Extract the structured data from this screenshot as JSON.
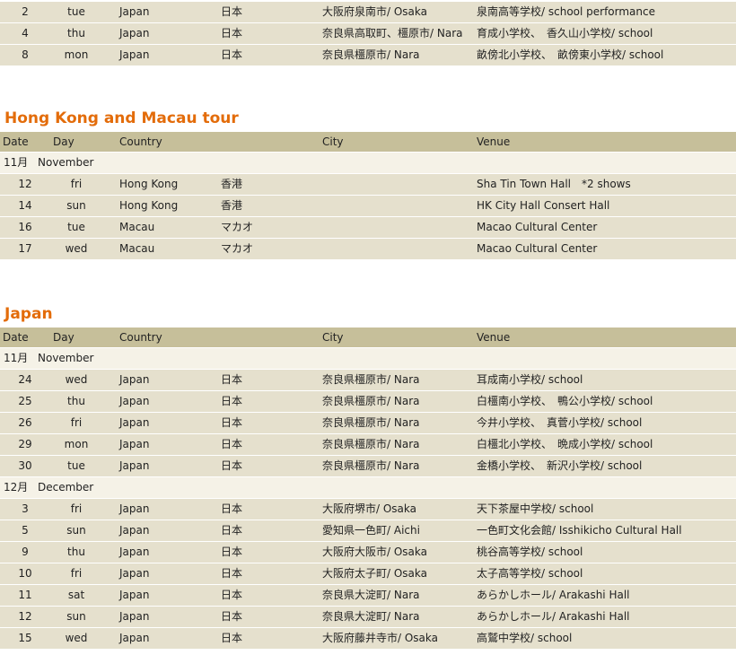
{
  "top_rows": [
    {
      "date": "2",
      "day": "tue",
      "country": "Japan",
      "ja": "日本",
      "city": "大阪府泉南市/ Osaka",
      "venue": "泉南高等学校/ school performance"
    },
    {
      "date": "4",
      "day": "thu",
      "country": "Japan",
      "ja": "日本",
      "city": "奈良県高取町、橿原市/ Nara",
      "venue": "育成小学校、　香久山小学校/ school"
    },
    {
      "date": "8",
      "day": "mon",
      "country": "Japan",
      "ja": "日本",
      "city": "奈良県橿原市/ Nara",
      "venue": "畝傍北小学校、　畝傍東小学校/ school"
    }
  ],
  "hk": {
    "title": "Hong Kong and Macau tour",
    "header": {
      "date": "Date",
      "day": "Day",
      "country": "Country",
      "city": "City",
      "venue": "Venue"
    },
    "month": {
      "num": "11月",
      "name": "November"
    },
    "rows": [
      {
        "date": "12",
        "day": "fri",
        "country": "Hong Kong",
        "ja": "香港",
        "city": "",
        "venue": "Sha Tin Town Hall　*2 shows"
      },
      {
        "date": "14",
        "day": "sun",
        "country": "Hong Kong",
        "ja": "香港",
        "city": "",
        "venue": "HK City Hall Consert Hall"
      },
      {
        "date": "16",
        "day": "tue",
        "country": "Macau",
        "ja": "マカオ",
        "city": "",
        "venue": "Macao Cultural Center"
      },
      {
        "date": "17",
        "day": "wed",
        "country": "Macau",
        "ja": "マカオ",
        "city": "",
        "venue": "Macao Cultural Center"
      }
    ]
  },
  "jp": {
    "title": "Japan",
    "header": {
      "date": "Date",
      "day": "Day",
      "country": "Country",
      "city": "City",
      "venue": "Venue"
    },
    "months": [
      {
        "num": "11月",
        "name": "November",
        "rows": [
          {
            "date": "24",
            "day": "wed",
            "country": "Japan",
            "ja": "日本",
            "city": "奈良県橿原市/ Nara",
            "venue": "耳成南小学校/ school"
          },
          {
            "date": "25",
            "day": "thu",
            "country": "Japan",
            "ja": "日本",
            "city": "奈良県橿原市/ Nara",
            "venue": "白橿南小学校、　鴨公小学校/ school"
          },
          {
            "date": "26",
            "day": "fri",
            "country": "Japan",
            "ja": "日本",
            "city": "奈良県橿原市/ Nara",
            "venue": "今井小学校、　真菅小学校/ school"
          },
          {
            "date": "29",
            "day": "mon",
            "country": "Japan",
            "ja": "日本",
            "city": "奈良県橿原市/ Nara",
            "venue": "白橿北小学校、　晩成小学校/ school"
          },
          {
            "date": "30",
            "day": "tue",
            "country": "Japan",
            "ja": "日本",
            "city": "奈良県橿原市/ Nara",
            "venue": "金橋小学校、　新沢小学校/ school"
          }
        ]
      },
      {
        "num": "12月",
        "name": "December",
        "rows": [
          {
            "date": "3",
            "day": "fri",
            "country": "Japan",
            "ja": "日本",
            "city": "大阪府堺市/ Osaka",
            "venue": "天下茶屋中学校/ school"
          },
          {
            "date": "5",
            "day": "sun",
            "country": "Japan",
            "ja": "日本",
            "city": "愛知県一色町/ Aichi",
            "venue": "一色町文化会館/ Isshikicho Cultural Hall"
          },
          {
            "date": "9",
            "day": "thu",
            "country": "Japan",
            "ja": "日本",
            "city": "大阪府大阪市/ Osaka",
            "venue": "桃谷高等学校/ school"
          },
          {
            "date": "10",
            "day": "fri",
            "country": "Japan",
            "ja": "日本",
            "city": "大阪府太子町/ Osaka",
            "venue": "太子高等学校/ school"
          },
          {
            "date": "11",
            "day": "sat",
            "country": "Japan",
            "ja": "日本",
            "city": "奈良県大淀町/ Nara",
            "venue": "あらかしホール/ Arakashi Hall"
          },
          {
            "date": "12",
            "day": "sun",
            "country": "Japan",
            "ja": "日本",
            "city": "奈良県大淀町/ Nara",
            "venue": "あらかしホール/ Arakashi Hall"
          },
          {
            "date": "15",
            "day": "wed",
            "country": "Japan",
            "ja": "日本",
            "city": "大阪府藤井寺市/ Osaka",
            "venue": "高鷲中学校/ school"
          }
        ]
      }
    ]
  }
}
